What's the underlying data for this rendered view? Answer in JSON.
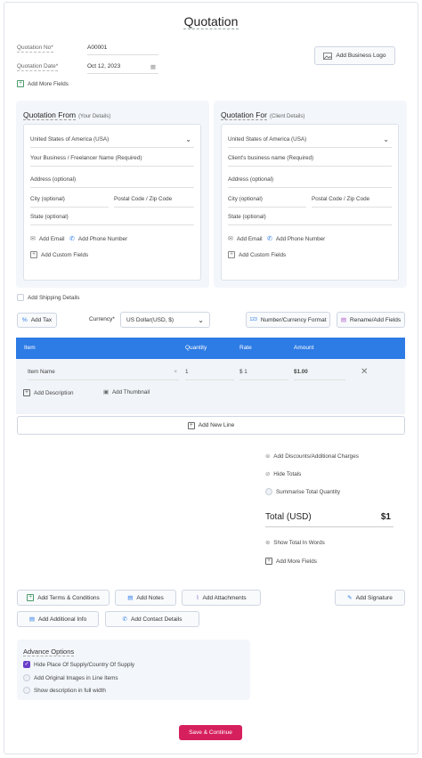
{
  "page": {
    "title": "Quotation"
  },
  "meta": {
    "quotation_no_label": "Quotation No*",
    "quotation_no_value": "A00001",
    "quotation_date_label": "Quotation Date*",
    "quotation_date_value": "Oct 12, 2023",
    "add_more_fields": "Add More Fields",
    "add_business_logo": "Add Business Logo"
  },
  "from": {
    "title": "Quotation From",
    "subtitle": "(Your Details)",
    "country": "United States of America (USA)",
    "name_placeholder": "Your Business / Freelancer Name (Required)",
    "address_placeholder": "Address (optional)",
    "city_placeholder": "City (optional)",
    "postal_placeholder": "Postal Code / Zip Code",
    "state_placeholder": "State (optional)",
    "add_email": "Add Email",
    "add_phone": "Add Phone Number",
    "add_custom": "Add Custom Fields"
  },
  "for": {
    "title": "Quotation For",
    "subtitle": "(Client Details)",
    "country": "United States of America (USA)",
    "name_placeholder": "Client's business name (Required)",
    "address_placeholder": "Address (optional)",
    "city_placeholder": "City (optional)",
    "postal_placeholder": "Postal Code / Zip Code",
    "state_placeholder": "State (optional)",
    "add_email": "Add Email",
    "add_phone": "Add Phone Number",
    "add_custom": "Add Custom Fields"
  },
  "shipping": {
    "label": "Add Shipping Details"
  },
  "toolbar": {
    "add_tax": "Add Tax",
    "currency_label": "Currency*",
    "currency_value": "US Dollar(USD, $)",
    "number_format": "Number/Currency Format",
    "rename_fields": "Rename/Add Fields"
  },
  "table": {
    "headers": [
      "Item",
      "Quantity",
      "Rate",
      "Amount"
    ],
    "row": {
      "item": "Item Name",
      "quantity": "1",
      "rate": "$ 1",
      "amount": "$1.00"
    },
    "add_description": "Add Description",
    "add_thumbnail": "Add Thumbnail",
    "add_new_line": "Add New Line"
  },
  "totals": {
    "add_discounts": "Add Discounts/Additional Charges",
    "hide_totals": "Hide Totals",
    "summarise_qty": "Summarise Total Quantity",
    "total_label": "Total (USD)",
    "total_value": "$1",
    "show_words": "Show Total In Words",
    "add_more_fields": "Add More Fields"
  },
  "actions": {
    "terms": "Add Terms & Conditions",
    "notes": "Add Notes",
    "attachments": "Add Attachments",
    "signature": "Add Signature",
    "additional_info": "Add Additional Info",
    "contact_details": "Add Contact Details"
  },
  "advanced": {
    "title": "Advance Options",
    "opt1": "Hide Place Of Supply/Country Of Supply",
    "opt2": "Add Original Images in Line Items",
    "opt3": "Show description in full width",
    "opt1_checked": true
  },
  "footer": {
    "save": "Save & Continue"
  },
  "colors": {
    "accent": "#2d7be5",
    "save": "#d6205e",
    "check": "#6a3fc9"
  }
}
